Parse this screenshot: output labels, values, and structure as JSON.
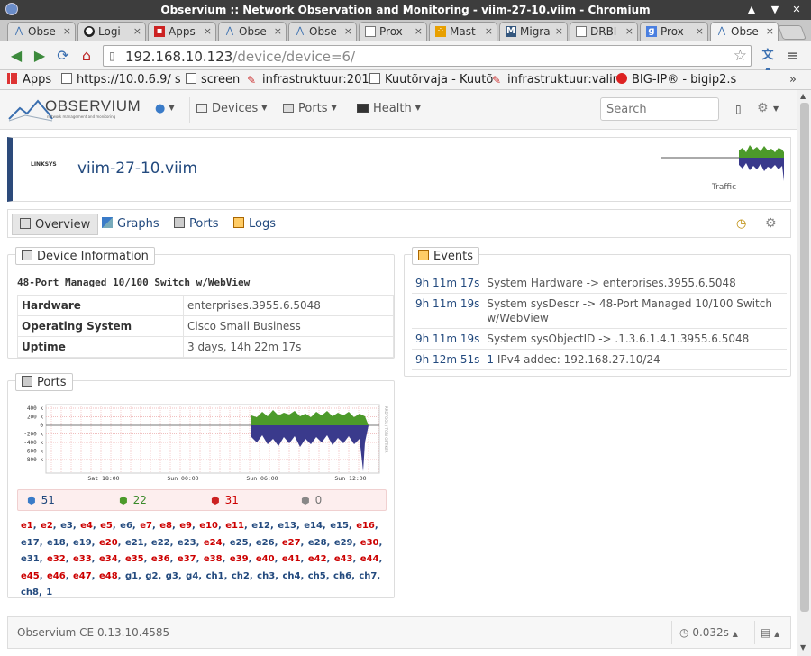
{
  "window": {
    "title": "Observium :: Network Observation and Monitoring - viim-27-10.viim - Chromium"
  },
  "tabs": [
    {
      "label": "Obse",
      "icon": "observium-icon"
    },
    {
      "label": "Logi",
      "icon": "github-icon"
    },
    {
      "label": "Apps",
      "icon": "apps-icon"
    },
    {
      "label": "Obse",
      "icon": "observium-icon"
    },
    {
      "label": "Obse",
      "icon": "observium-icon"
    },
    {
      "label": "Prox",
      "icon": "page-icon"
    },
    {
      "label": "Mast",
      "icon": "mast-icon"
    },
    {
      "label": "Migra",
      "icon": "migra-icon"
    },
    {
      "label": "DRBI",
      "icon": "page-icon"
    },
    {
      "label": "Prox",
      "icon": "google-icon"
    },
    {
      "label": "Obse",
      "icon": "observium-icon"
    }
  ],
  "address": {
    "host": "192.168.10.123",
    "path": "/device/device=6/"
  },
  "bookmarks": [
    {
      "label": "Apps"
    },
    {
      "label": "https://10.0.6.9/ s"
    },
    {
      "label": "screen"
    },
    {
      "label": "infrastruktuur:201"
    },
    {
      "label": "Kuutõrvaja - Kuutõ"
    },
    {
      "label": "infrastruktuur:valir"
    },
    {
      "label": "BIG-IP® - bigip2.s"
    }
  ],
  "nav": {
    "logo_text": "OBSERVIUM",
    "logo_tagline": "network management and monitoring",
    "devices": "Devices",
    "ports": "Ports",
    "health": "Health",
    "search_placeholder": "Search"
  },
  "device": {
    "vendor_logo": "LINKSYS",
    "hostname": "viim-27-10.viim",
    "traffic_label": "Traffic"
  },
  "device_tabs": {
    "overview": "Overview",
    "graphs": "Graphs",
    "ports": "Ports",
    "logs": "Logs"
  },
  "device_info": {
    "title": "Device Information",
    "description": "48-Port Managed 10/100 Switch w/WebView",
    "rows": [
      {
        "key": "Hardware",
        "value": "enterprises.3955.6.5048"
      },
      {
        "key": "Operating System",
        "value": "Cisco Small Business"
      },
      {
        "key": "Uptime",
        "value": "3 days, 14h 22m 17s"
      }
    ]
  },
  "events": {
    "title": "Events",
    "rows": [
      {
        "time": "9h 11m 17s",
        "message": "System Hardware -> enterprises.3955.6.5048"
      },
      {
        "time": "9h 11m 19s",
        "message": "System sysDescr -> 48-Port Managed 10/100 Switch w/WebView"
      },
      {
        "time": "9h 11m 19s",
        "message": "System sysObjectID -> .1.3.6.1.4.1.3955.6.5048"
      },
      {
        "time": "9h 12m 51s",
        "link": "1",
        "message": "IPv4 addec: 192.168.27.10/24"
      }
    ]
  },
  "ports": {
    "title": "Ports",
    "counts": {
      "total": "51",
      "up": "22",
      "down": "31",
      "disabled": "0"
    },
    "graph": {
      "y_labels": [
        "400 k",
        "200 k",
        "0",
        "-200 k",
        "-400 k",
        "-600 k",
        "-800 k"
      ],
      "x_labels": [
        "Sat 18:00",
        "Sun 00:00",
        "Sun 06:00",
        "Sun 12:00"
      ],
      "side_label": "RRDTOOL / TOBI OETIKER"
    },
    "list": [
      {
        "n": "e1",
        "s": "d"
      },
      {
        "n": "e2",
        "s": "d"
      },
      {
        "n": "e3",
        "s": "u"
      },
      {
        "n": "e4",
        "s": "d"
      },
      {
        "n": "e5",
        "s": "d"
      },
      {
        "n": "e6",
        "s": "u"
      },
      {
        "n": "e7",
        "s": "d"
      },
      {
        "n": "e8",
        "s": "d"
      },
      {
        "n": "e9",
        "s": "d"
      },
      {
        "n": "e10",
        "s": "d"
      },
      {
        "n": "e11",
        "s": "d"
      },
      {
        "n": "e12",
        "s": "u"
      },
      {
        "n": "e13",
        "s": "u"
      },
      {
        "n": "e14",
        "s": "u"
      },
      {
        "n": "e15",
        "s": "u"
      },
      {
        "n": "e16",
        "s": "d"
      },
      {
        "n": "e17",
        "s": "u"
      },
      {
        "n": "e18",
        "s": "u"
      },
      {
        "n": "e19",
        "s": "u"
      },
      {
        "n": "e20",
        "s": "d"
      },
      {
        "n": "e21",
        "s": "u"
      },
      {
        "n": "e22",
        "s": "u"
      },
      {
        "n": "e23",
        "s": "u"
      },
      {
        "n": "e24",
        "s": "d"
      },
      {
        "n": "e25",
        "s": "u"
      },
      {
        "n": "e26",
        "s": "u"
      },
      {
        "n": "e27",
        "s": "d"
      },
      {
        "n": "e28",
        "s": "u"
      },
      {
        "n": "e29",
        "s": "u"
      },
      {
        "n": "e30",
        "s": "d"
      },
      {
        "n": "e31",
        "s": "u"
      },
      {
        "n": "e32",
        "s": "d"
      },
      {
        "n": "e33",
        "s": "d"
      },
      {
        "n": "e34",
        "s": "d"
      },
      {
        "n": "e35",
        "s": "d"
      },
      {
        "n": "e36",
        "s": "d"
      },
      {
        "n": "e37",
        "s": "d"
      },
      {
        "n": "e38",
        "s": "d"
      },
      {
        "n": "e39",
        "s": "d"
      },
      {
        "n": "e40",
        "s": "d"
      },
      {
        "n": "e41",
        "s": "d"
      },
      {
        "n": "e42",
        "s": "d"
      },
      {
        "n": "e43",
        "s": "d"
      },
      {
        "n": "e44",
        "s": "d"
      },
      {
        "n": "e45",
        "s": "d"
      },
      {
        "n": "e46",
        "s": "d"
      },
      {
        "n": "e47",
        "s": "d"
      },
      {
        "n": "e48",
        "s": "d"
      },
      {
        "n": "g1",
        "s": "u"
      },
      {
        "n": "g2",
        "s": "u"
      },
      {
        "n": "g3",
        "s": "u"
      },
      {
        "n": "g4",
        "s": "u"
      },
      {
        "n": "ch1",
        "s": "u"
      },
      {
        "n": "ch2",
        "s": "u"
      },
      {
        "n": "ch3",
        "s": "u"
      },
      {
        "n": "ch4",
        "s": "u"
      },
      {
        "n": "ch5",
        "s": "u"
      },
      {
        "n": "ch6",
        "s": "u"
      },
      {
        "n": "ch7",
        "s": "u"
      },
      {
        "n": "ch8",
        "s": "u"
      },
      {
        "n": "1",
        "s": "u"
      }
    ]
  },
  "footer": {
    "version": "Observium CE 0.13.10.4585",
    "timing": "0.032s"
  },
  "colors": {
    "accent": "#234a7e",
    "port_up": "#234a7e",
    "port_down": "#cc0000",
    "traffic_in": "#4c9a2a",
    "traffic_out": "#3a3a8c"
  }
}
